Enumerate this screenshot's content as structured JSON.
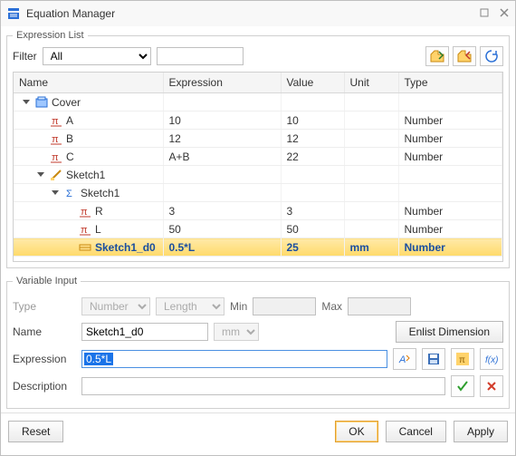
{
  "window": {
    "title": "Equation Manager"
  },
  "expression_list": {
    "legend": "Expression List",
    "filter_label": "Filter",
    "filter_value": "All",
    "search_value": "",
    "columns": {
      "name": "Name",
      "expression": "Expression",
      "value": "Value",
      "unit": "Unit",
      "type": "Type"
    },
    "rows": [
      {
        "indent": 0,
        "expander": true,
        "icon": "part-icon",
        "name": "Cover",
        "expression": "",
        "value": "",
        "unit": "",
        "type": "",
        "selected": false
      },
      {
        "indent": 1,
        "expander": false,
        "icon": "pi-icon",
        "name": "A",
        "expression": "10",
        "value": "10",
        "unit": "",
        "type": "Number",
        "selected": false
      },
      {
        "indent": 1,
        "expander": false,
        "icon": "pi-icon",
        "name": "B",
        "expression": "12",
        "value": "12",
        "unit": "",
        "type": "Number",
        "selected": false
      },
      {
        "indent": 1,
        "expander": false,
        "icon": "pi-icon",
        "name": "C",
        "expression": "A+B",
        "value": "22",
        "unit": "",
        "type": "Number",
        "selected": false
      },
      {
        "indent": 1,
        "expander": true,
        "icon": "sketch-icon",
        "name": "Sketch1",
        "expression": "",
        "value": "",
        "unit": "",
        "type": "",
        "selected": false
      },
      {
        "indent": 2,
        "expander": true,
        "icon": "sigma-icon",
        "name": "Sketch1",
        "expression": "",
        "value": "",
        "unit": "",
        "type": "",
        "selected": false
      },
      {
        "indent": 3,
        "expander": false,
        "icon": "pi-icon",
        "name": "R",
        "expression": "3",
        "value": "3",
        "unit": "",
        "type": "Number",
        "selected": false
      },
      {
        "indent": 3,
        "expander": false,
        "icon": "pi-icon",
        "name": "L",
        "expression": "50",
        "value": "50",
        "unit": "",
        "type": "Number",
        "selected": false
      },
      {
        "indent": 3,
        "expander": false,
        "icon": "dim-icon",
        "name": "Sketch1_d0",
        "expression": "0.5*L",
        "value": "25",
        "unit": "mm",
        "type": "Number",
        "selected": true
      }
    ]
  },
  "variable_input": {
    "legend": "Variable Input",
    "type_label": "Type",
    "type_value": "Number",
    "length_value": "Length",
    "min_label": "Min",
    "min_value": "",
    "max_label": "Max",
    "max_value": "",
    "name_label": "Name",
    "name_value": "Sketch1_d0",
    "unit_value": "mm",
    "enlist_label": "Enlist Dimension",
    "expression_label": "Expression",
    "expression_value": "0.5*L",
    "description_label": "Description",
    "description_value": ""
  },
  "footer": {
    "reset": "Reset",
    "ok": "OK",
    "cancel": "Cancel",
    "apply": "Apply"
  }
}
